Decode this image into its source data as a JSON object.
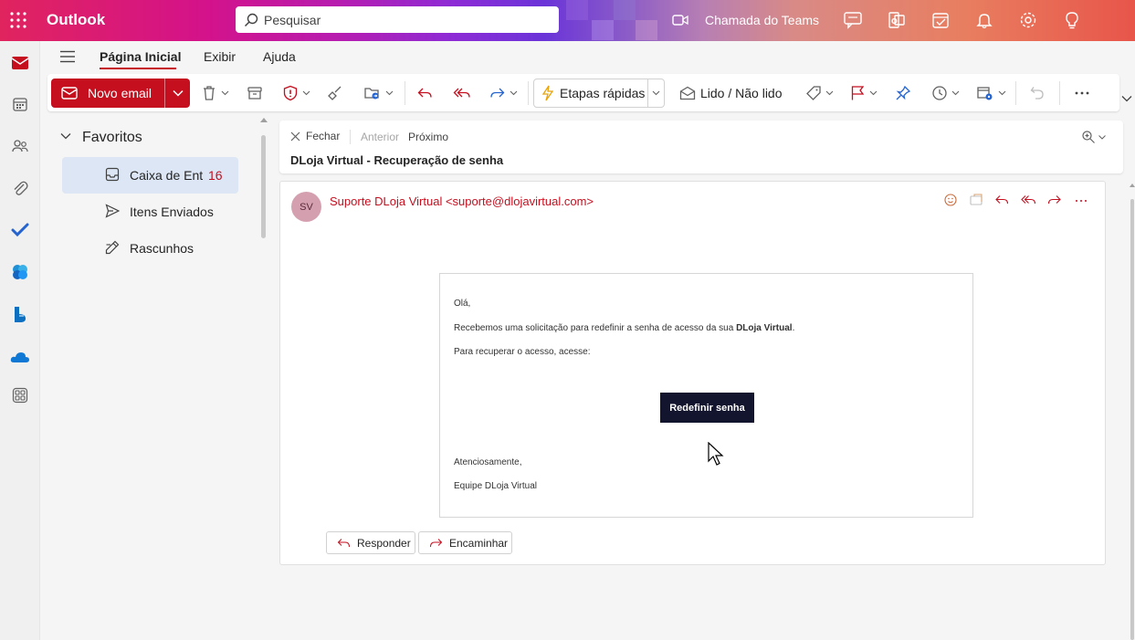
{
  "app": {
    "brand": "Outlook"
  },
  "search": {
    "placeholder": "Pesquisar"
  },
  "header": {
    "teams_call": "Chamada do Teams"
  },
  "tabs": [
    {
      "label": "Página Inicial",
      "active": true
    },
    {
      "label": "Exibir"
    },
    {
      "label": "Ajuda"
    }
  ],
  "ribbon": {
    "new_mail": "Novo email",
    "quick_steps": "Etapas rápidas",
    "read_unread": "Lido / Não lido"
  },
  "folders": {
    "favorites": "Favoritos",
    "items": [
      {
        "label": "Caixa de Ent",
        "count": "16",
        "selected": true
      },
      {
        "label": "Itens Enviados"
      },
      {
        "label": "Rascunhos"
      }
    ]
  },
  "reading": {
    "close": "Fechar",
    "previous": "Anterior",
    "next": "Próximo",
    "subject": "DLoja Virtual - Recuperação de senha"
  },
  "message": {
    "avatar_initials": "SV",
    "sender": "Suporte DLoja Virtual <suporte@dlojavirtual.com>",
    "body": {
      "greeting": "Olá,",
      "line1_prefix": "Recebemos uma solicitação para redefinir a senha de acesso da sua ",
      "line1_bold": "DLoja Virtual",
      "line1_suffix": ".",
      "line2": "Para recuperar o acesso, acesse:",
      "button": "Redefinir senha",
      "closing": "Atenciosamente,",
      "signature": "Equipe DLoja Virtual"
    },
    "reply": "Responder",
    "forward": "Encaminhar"
  },
  "colors": {
    "accent": "#c50f1f",
    "selected_folder": "#dce6f4",
    "email_button": "#13142e",
    "avatar": "#d4a0b0"
  }
}
